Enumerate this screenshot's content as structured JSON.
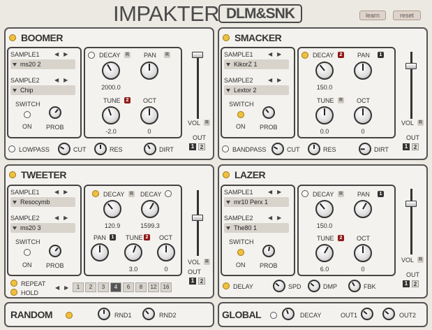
{
  "header": {
    "title": "IMPAKTER",
    "subtitle": "DLM&SNK",
    "learn": "learn",
    "reset": "reset"
  },
  "common": {
    "sample1": "SAMPLE1",
    "sample2": "SAMPLE2",
    "switch": "SWITCH",
    "on": "ON",
    "prob": "PROB",
    "decay": "DECAY",
    "pan": "PAN",
    "tune": "TUNE",
    "oct": "OCT",
    "vol": "VOL",
    "out": "OUT",
    "r": "R",
    "out1": "1",
    "out2": "2",
    "cut": "CUT",
    "res": "RES",
    "dirt": "DIRT",
    "spd": "SPD",
    "dmp": "DMP",
    "fbk": "FBK"
  },
  "boomer": {
    "title": "BOOMER",
    "sample1": "ms20 2",
    "sample2": "Chip",
    "decay": "2000.0",
    "tune": "-2.0",
    "oct": "0",
    "tune_badge": "2",
    "filter": "LOWPASS"
  },
  "smacker": {
    "title": "SMACKER",
    "sample1": "KikorZ 1",
    "sample2": "Lextor 2",
    "decay": "150.0",
    "tune": "0.0",
    "oct": "0",
    "decay_badge": "2",
    "pan_badge": "1",
    "filter": "BANDPASS"
  },
  "tweeter": {
    "title": "TWEETER",
    "sample1": "Resocymb",
    "sample2": "ms20 3",
    "decay1": "120.9",
    "decay2": "1599.3",
    "tune": "3.0",
    "oct": "0",
    "pan_badge": "1",
    "tune_badge": "2",
    "repeat": "REPEAT",
    "hold": "HOLD",
    "steps": [
      "1",
      "2",
      "3",
      "4",
      "6",
      "8",
      "12",
      "16"
    ],
    "active_step": "4"
  },
  "lazer": {
    "title": "LAZER",
    "sample1": "mr10 Perx 1",
    "sample2": "The80 1",
    "decay": "150.0",
    "tune": "6.0",
    "oct": "0",
    "pan_badge": "1",
    "tune_badge": "2",
    "delay": "DELAY"
  },
  "random": {
    "title": "RANDOM",
    "rnd1": "RND1",
    "rnd2": "RND2"
  },
  "global": {
    "title": "GLOBAL",
    "decay": "DECAY",
    "out1": "OUT1",
    "out2": "OUT2"
  }
}
